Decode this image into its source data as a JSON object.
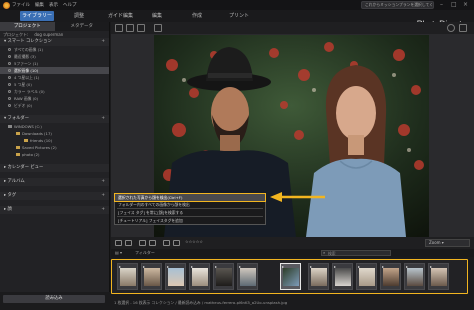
{
  "menubar": {
    "items": [
      "ファイル",
      "編集",
      "表示",
      "ヘルプ"
    ],
    "notice": "これからミッションプランを選択してください"
  },
  "modes": {
    "library": "ライブラリー",
    "tabs": [
      "調整",
      "ガイド編集",
      "編集",
      "作成",
      "プリント"
    ]
  },
  "brand": "PhotoDirector",
  "left_panel": {
    "tabs": [
      "プロジェクト",
      "メタデータ"
    ],
    "project_label": "プロジェクト:",
    "project_name": "dog superman",
    "smart_collections": {
      "title": "スマート コレクション",
      "items": [
        "すべての画像 (1)",
        "最近撮影 (3)",
        "5ファーン (1)",
        "選択画像 (10)",
        "4 つ星以上 (1)",
        "5 つ星 (0)",
        "カラー ラベル (0)",
        "RAW 画像 (0)",
        "ビデオ (0)"
      ]
    },
    "folders": {
      "title": "フォルダー",
      "items": [
        "WINDOWS (C:)",
        "Downloads (17)",
        "friends (10)",
        "Saved Pictures (2)",
        "photo (2)"
      ]
    },
    "sections": [
      "カレンダー ビュー",
      "アルバム",
      "タグ",
      "顔"
    ],
    "import_button": "読み込み"
  },
  "context_menu": {
    "items": [
      "選択された写真から顔を検出(Ctrl+F)",
      "フォルダー内のすべての画像から顔を検出",
      "[フェイス タグ] を常に[顔]を検索する",
      "[チュートリアル] フェイスタグを追加"
    ],
    "highlighted_index": 0
  },
  "view_controls": {
    "zoom": "Zoom"
  },
  "filter_bar": {
    "label": "フィルター",
    "search_placeholder": "検索"
  },
  "status": {
    "text": "1 枚選択 - 16 枚表示    コレクション / 最新読み込み / matheus-ferrero-pI6nK5_a2Uo-unsplash.jpg"
  },
  "colors": {
    "accent": "#f2b520",
    "library_tab": "#3a6fb5"
  }
}
